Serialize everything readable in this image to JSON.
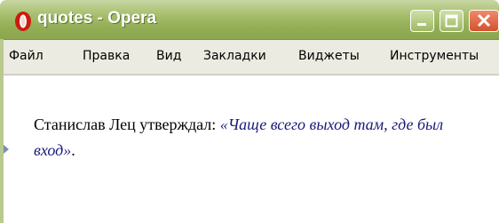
{
  "window": {
    "title": "quotes - Opera"
  },
  "menu": [
    "Файл",
    "Правка",
    "Вид",
    "Закладки",
    "Виджеты",
    "Инструменты"
  ],
  "content": {
    "lead": "Станислав Лец утверждал: ",
    "quote": "«Чаще всего выход там, где был вход»",
    "tail": "."
  },
  "colors": {
    "titlebar": "#9db662",
    "quote": "#1a1a7a",
    "close_button": "#d4512e"
  },
  "icons": {
    "logo": "opera-logo-icon",
    "minimize": "minimize-icon",
    "maximize": "maximize-icon",
    "close": "close-icon"
  }
}
